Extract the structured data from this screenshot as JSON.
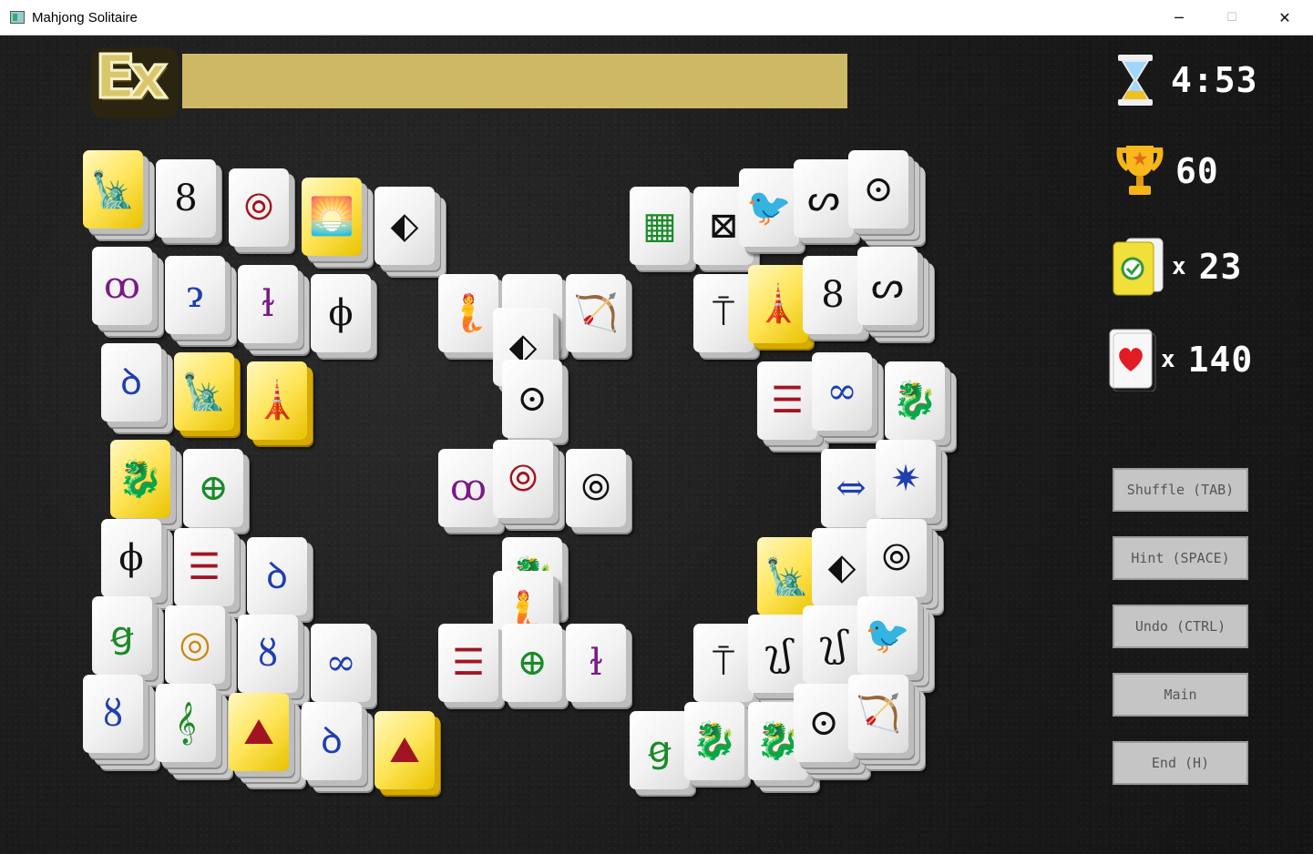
{
  "window": {
    "title": "Mahjong Solitaire",
    "minimize": "─",
    "maximize": "☐",
    "close": "✕"
  },
  "badge": {
    "text": "Ex"
  },
  "hud": {
    "timer": {
      "icon": "hourglass-icon",
      "value": "4:53"
    },
    "score": {
      "icon": "trophy-icon",
      "value": "60"
    },
    "matches": {
      "icon": "checkmark-card-icon",
      "multiplier": "x",
      "value": "23"
    },
    "lives": {
      "icon": "heart-card-icon",
      "multiplier": "x",
      "value": "140"
    }
  },
  "buttons": {
    "shuffle": "Shuffle (TAB)",
    "hint": "Hint (SPACE)",
    "undo": "Undo (CTRL)",
    "main": "Main",
    "end": "End (H)"
  },
  "colors": {
    "accent": "#cdb866",
    "tile_gold": "#ffe55a",
    "button": "#c5c5c5"
  },
  "tiles": [
    {
      "symbol": "🗽",
      "name": "statue-of-liberty",
      "style": "gold"
    },
    {
      "symbol": "8",
      "name": "swirl-eight",
      "style": "white"
    },
    {
      "symbol": "⦾",
      "name": "double-ring-red",
      "style": "white"
    },
    {
      "symbol": "🌅",
      "name": "sunrise-wave",
      "style": "gold"
    },
    {
      "symbol": "⬖",
      "name": "arrow-diamond",
      "style": "white"
    },
    {
      "symbol": "ꝏ",
      "name": "glyph-purple",
      "style": "white"
    },
    {
      "symbol": "ɂ",
      "name": "glyph-blue",
      "style": "white"
    },
    {
      "symbol": "ɫ",
      "name": "glyph-purple-2",
      "style": "white"
    },
    {
      "symbol": "ϕ",
      "name": "glyph-black",
      "style": "white"
    },
    {
      "symbol": "ꝺ",
      "name": "glyph-blue-2",
      "style": "white"
    },
    {
      "symbol": "🗽",
      "name": "statue-of-liberty-2",
      "style": "gold"
    },
    {
      "symbol": "🗼",
      "name": "tower",
      "style": "gold"
    },
    {
      "symbol": "🐉",
      "name": "dragon",
      "style": "gold"
    },
    {
      "symbol": "⊕",
      "name": "green-circle",
      "style": "white"
    },
    {
      "symbol": "ϕ",
      "name": "glyph-black-2",
      "style": "white"
    },
    {
      "symbol": "☰",
      "name": "red-bars",
      "style": "white"
    },
    {
      "symbol": "ꝺ",
      "name": "glyph-blue-3",
      "style": "white"
    },
    {
      "symbol": "ꞡ",
      "name": "glyph-green",
      "style": "white"
    },
    {
      "symbol": "◎",
      "name": "gold-ring",
      "style": "white"
    },
    {
      "symbol": "ȣ",
      "name": "glyph-blue-4",
      "style": "white"
    },
    {
      "symbol": "∞",
      "name": "infinity-blue",
      "style": "white"
    },
    {
      "symbol": "ȣ",
      "name": "glyph-blue-5",
      "style": "white"
    },
    {
      "symbol": "𝄞",
      "name": "bamboo",
      "style": "white"
    },
    {
      "symbol": "⛰",
      "name": "pyramid",
      "style": "gold"
    },
    {
      "symbol": "ꝺ",
      "name": "glyph-blue-6",
      "style": "white"
    },
    {
      "symbol": "⛰",
      "name": "pyramid-2",
      "style": "gold"
    },
    {
      "symbol": "🧜",
      "name": "mermaid",
      "style": "white"
    },
    {
      "symbol": "ᔕ",
      "name": "glyph-script",
      "style": "white"
    },
    {
      "symbol": "🏹",
      "name": "archer",
      "style": "white"
    },
    {
      "symbol": "⬖",
      "name": "arrow-diamond-2",
      "style": "white"
    },
    {
      "symbol": "⊙",
      "name": "dot-circle",
      "style": "white"
    },
    {
      "symbol": "ꝏ",
      "name": "glyph-purple-3",
      "style": "white"
    },
    {
      "symbol": "⦾",
      "name": "double-ring-red-2",
      "style": "white"
    },
    {
      "symbol": "⦾",
      "name": "triple-ring",
      "style": "white"
    },
    {
      "symbol": "🐉",
      "name": "dragon-2",
      "style": "white"
    },
    {
      "symbol": "🧜",
      "name": "mermaid-2",
      "style": "white"
    },
    {
      "symbol": "☰",
      "name": "red-bars-2",
      "style": "white"
    },
    {
      "symbol": "⊕",
      "name": "green-circle-2",
      "style": "white"
    },
    {
      "symbol": "ɫ",
      "name": "glyph-purple-4",
      "style": "white"
    },
    {
      "symbol": "▦",
      "name": "bamboo-lattice",
      "style": "white"
    },
    {
      "symbol": "⊠",
      "name": "knot",
      "style": "white"
    },
    {
      "symbol": "🐦",
      "name": "phoenix",
      "style": "white"
    },
    {
      "symbol": "ᔕ",
      "name": "glyph-script-2",
      "style": "white"
    },
    {
      "symbol": "⊙",
      "name": "dot-circle-2",
      "style": "white"
    },
    {
      "symbol": "⍑",
      "name": "glyph-arrow",
      "style": "white"
    },
    {
      "symbol": "🗼",
      "name": "tower-2",
      "style": "gold"
    },
    {
      "symbol": "8",
      "name": "swirl-eight-2",
      "style": "white"
    },
    {
      "symbol": "ᔕ",
      "name": "glyph-script-3",
      "style": "white"
    },
    {
      "symbol": "☰",
      "name": "red-bars-3",
      "style": "white"
    },
    {
      "symbol": "∞",
      "name": "infinity-blue-2",
      "style": "white"
    },
    {
      "symbol": "🐉",
      "name": "dragon-3",
      "style": "white"
    },
    {
      "symbol": "⇔",
      "name": "blue-green-arrows",
      "style": "white"
    },
    {
      "symbol": "✷",
      "name": "compass-star",
      "style": "white"
    },
    {
      "symbol": "🗽",
      "name": "statue-of-liberty-3",
      "style": "gold"
    },
    {
      "symbol": "⬖",
      "name": "arrow-diamond-3",
      "style": "white"
    },
    {
      "symbol": "⦾",
      "name": "triple-ring-2",
      "style": "white"
    },
    {
      "symbol": "⍑",
      "name": "glyph-arrow-2",
      "style": "white"
    },
    {
      "symbol": "ʅʃ",
      "name": "glyph-hooks",
      "style": "white"
    },
    {
      "symbol": "ʅʃ",
      "name": "glyph-hooks-2",
      "style": "white"
    },
    {
      "symbol": "🐦",
      "name": "phoenix-2",
      "style": "white"
    },
    {
      "symbol": "ꞡ",
      "name": "glyph-green-2",
      "style": "white"
    },
    {
      "symbol": "🐉",
      "name": "dragon-4",
      "style": "white"
    },
    {
      "symbol": "🐉",
      "name": "dragon-5",
      "style": "white"
    },
    {
      "symbol": "⊙",
      "name": "dot-circle-3",
      "style": "white"
    },
    {
      "symbol": "🏹",
      "name": "archer-2",
      "style": "white"
    }
  ]
}
